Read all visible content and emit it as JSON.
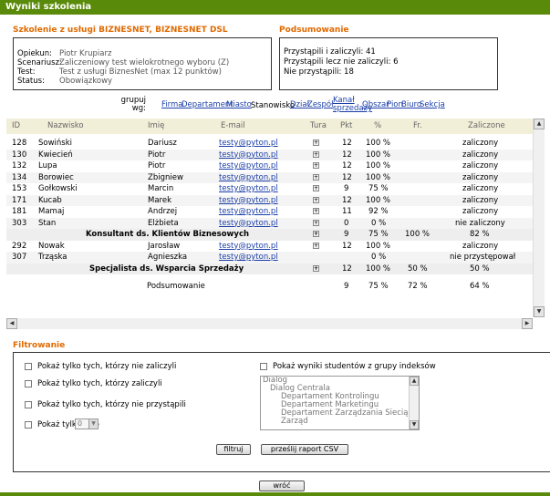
{
  "window": {
    "title": "Wyniki szkolenia"
  },
  "training": {
    "title": "Szkolenie z usługi BIZNESNET, BIZNESNET DSL",
    "fields": [
      {
        "key": "Opiekun:",
        "value": "Piotr Krupiarz"
      },
      {
        "key": "Scenariusz:",
        "value": "Zaliczeniowy test wielokrotnego wyboru  (Z)"
      },
      {
        "key": "Test:",
        "value": "Test z usługi BiznesNet (max 12 punktów)"
      },
      {
        "key": "Status:",
        "value": "Obowiązkowy"
      }
    ]
  },
  "summary": {
    "title": "Podsumowanie",
    "lines": [
      "Przystąpili i zaliczyli: 41",
      "Przystąpili lecz nie zaliczyli: 6",
      "Nie przystąpili: 18"
    ]
  },
  "groupby": {
    "label": "grupuj wg:",
    "options": [
      "Firma",
      "Departament",
      "Miasto",
      "Stanowisko",
      "Dział",
      "Zespół",
      "Kanał sprzedaży",
      "Obszar",
      "Pion",
      "Biuro",
      "Sekcja"
    ],
    "active": "Stanowisko"
  },
  "table": {
    "headers": {
      "id": "ID",
      "surname": "Nazwisko",
      "name": "Imię",
      "email": "E-mail",
      "round": "Tura",
      "pts": "Pkt",
      "pct": "%",
      "fr": "Fr.",
      "passed": "Zaliczone"
    },
    "rows1": [
      {
        "id": "128",
        "surname": "Sowiński",
        "name": "Dariusz",
        "email": "testy@pyton.pl",
        "pts": "12",
        "pct": "100 %",
        "passed": "zaliczony"
      },
      {
        "id": "130",
        "surname": "Kwiecień",
        "name": "Piotr",
        "email": "testy@pyton.pl",
        "pts": "12",
        "pct": "100 %",
        "passed": "zaliczony"
      },
      {
        "id": "132",
        "surname": "Lupa",
        "name": "Piotr",
        "email": "testy@pyton.pl",
        "pts": "12",
        "pct": "100 %",
        "passed": "zaliczony"
      },
      {
        "id": "134",
        "surname": "Borowiec",
        "name": "Zbigniew",
        "email": "testy@pyton.pl",
        "pts": "12",
        "pct": "100 %",
        "passed": "zaliczony"
      },
      {
        "id": "153",
        "surname": "Gołkowski",
        "name": "Marcin",
        "email": "testy@pyton.pl",
        "pts": "9",
        "pct": "75 %",
        "passed": "zaliczony"
      },
      {
        "id": "171",
        "surname": "Kucab",
        "name": "Marek",
        "email": "testy@pyton.pl",
        "pts": "12",
        "pct": "100 %",
        "passed": "zaliczony"
      },
      {
        "id": "181",
        "surname": "Mamaj",
        "name": "Andrzej",
        "email": "testy@pyton.pl",
        "pts": "11",
        "pct": "92 %",
        "passed": "zaliczony"
      },
      {
        "id": "303",
        "surname": "Stan",
        "name": "Elżbieta",
        "email": "testy@pyton.pl",
        "pts": "0",
        "pct": "0 %",
        "passed": "nie zaliczony"
      }
    ],
    "group1": {
      "label": "Konsultant ds. Klientów Biznesowych",
      "pts": "9",
      "pct": "75 %",
      "fr": "100 %",
      "passed": "82 %"
    },
    "rows2": [
      {
        "id": "292",
        "surname": "Nowak",
        "name": "Jarosław",
        "email": "testy@pyton.pl",
        "pts": "12",
        "pct": "100 %",
        "passed": "zaliczony"
      },
      {
        "id": "307",
        "surname": "Trząska",
        "name": "Agnieszka",
        "email": "testy@pyton.pl",
        "pts": "",
        "pct": "0 %",
        "passed": "nie przystępował"
      }
    ],
    "group2": {
      "label": "Specjalista ds. Wsparcia Sprzedaży",
      "pts": "12",
      "pct": "100 %",
      "fr": "50 %",
      "passed": "50 %"
    },
    "total": {
      "label": "Podsumowanie",
      "pts": "9",
      "pct": "75 %",
      "fr": "72 %",
      "passed": "64 %"
    }
  },
  "filter": {
    "title": "Filtrowanie",
    "not_passed": "Pokaż tylko tych, którzy nie zaliczyli",
    "passed": "Pokaż tylko tych, którzy zaliczyli",
    "not_taken": "Pokaż tylko tych, którzy nie przystąpili",
    "round": "Pokaż tylko turę",
    "round_value": "0",
    "index_groups": "Pokaż wyniki studentów z grupy indeksów",
    "tree": [
      "Dialog",
      "Dialog Centrala",
      "Departament Kontrolingu",
      "Departament Marketingu",
      "Departament Zarządzania Siecią",
      "Zarząd"
    ],
    "btn_filter": "filtruj",
    "btn_csv": "prześlij raport CSV"
  },
  "back_label": "wróć",
  "colors": {
    "titlebar": "#5a8a0a",
    "section_title": "#e06a00",
    "link": "#1a3ea8"
  }
}
